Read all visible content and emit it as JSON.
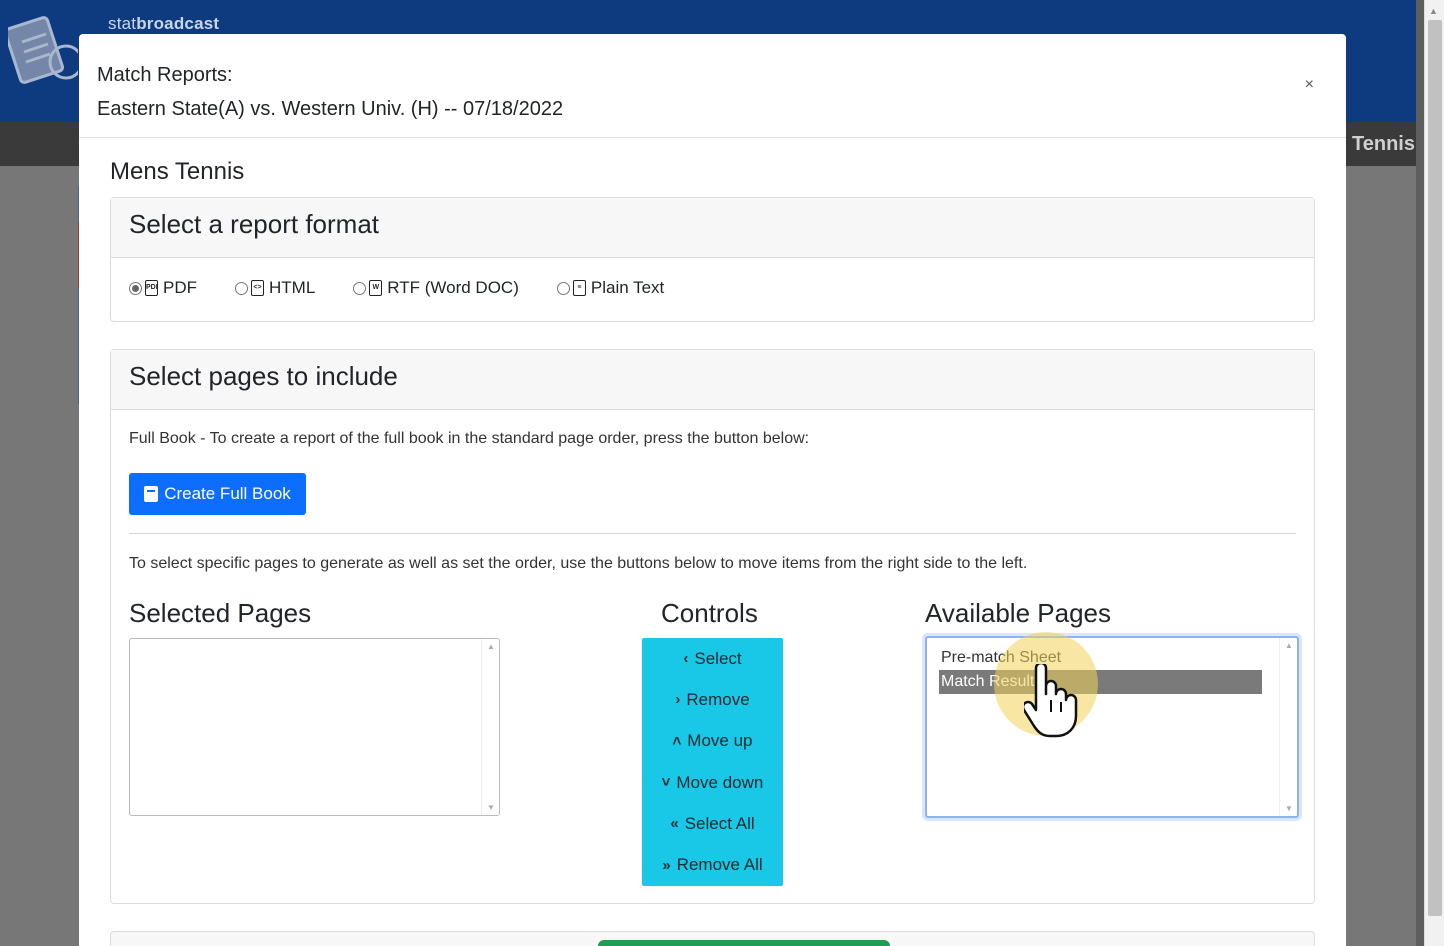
{
  "background": {
    "brand_prefix": "stat",
    "brand_bold": "broadcast",
    "nav_label": "Tennis"
  },
  "modal": {
    "title_line1": "Match Reports:",
    "title_line2": "Eastern State(A) vs. Western Univ. (H) -- 07/18/2022",
    "close_label": "×",
    "sport": "Mens Tennis"
  },
  "format_card": {
    "header": "Select a report format",
    "options": [
      {
        "label": "PDF",
        "icon": "pdf-file-icon",
        "checked": true
      },
      {
        "label": "HTML",
        "icon": "html-file-icon",
        "checked": false
      },
      {
        "label": "RTF (Word DOC)",
        "icon": "word-file-icon",
        "checked": false
      },
      {
        "label": "Plain Text",
        "icon": "text-file-icon",
        "checked": false
      }
    ]
  },
  "pages_card": {
    "header": "Select pages to include",
    "full_book_note": "Full Book - To create a report of the full book in the standard page order, press the button below:",
    "full_book_button": "Create Full Book",
    "select_note": "To select specific pages to generate as well as set the order, use the buttons below to move items from the right side to the left.",
    "selected_title": "Selected Pages",
    "controls_title": "Controls",
    "available_title": "Available Pages",
    "controls": [
      {
        "label": "Select",
        "glyph": "‹"
      },
      {
        "label": "Remove",
        "glyph": "›"
      },
      {
        "label": "Move up",
        "glyph": "˄"
      },
      {
        "label": "Move down",
        "glyph": "˅"
      },
      {
        "label": "Select All",
        "glyph": "«"
      },
      {
        "label": "Remove All",
        "glyph": "»"
      }
    ],
    "available_options": [
      "Pre-match Sheet",
      "Match Results"
    ],
    "available_active_index": 1
  },
  "colors": {
    "primary": "#0d6efd",
    "controls": "#19c8e6",
    "header_bg": "#0e3a80"
  }
}
